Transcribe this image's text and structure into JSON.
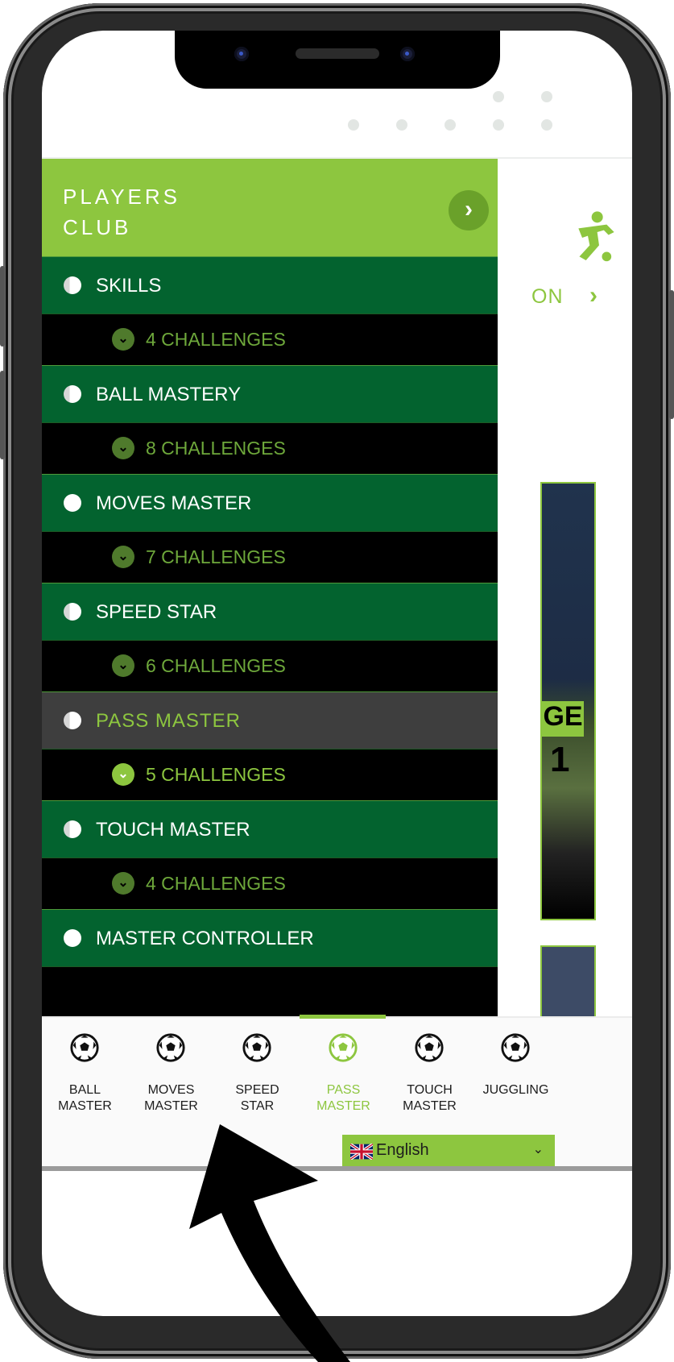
{
  "menu": {
    "title_line1": "PLAYERS",
    "title_line2": "CLUB",
    "categories": [
      {
        "label": "SKILLS",
        "challenges": "4 CHALLENGES"
      },
      {
        "label": "BALL MASTERY",
        "challenges": "8 CHALLENGES"
      },
      {
        "label": "MOVES MASTER",
        "challenges": "7 CHALLENGES"
      },
      {
        "label": "SPEED STAR",
        "challenges": "6 CHALLENGES"
      },
      {
        "label": "PASS MASTER",
        "challenges": "5 CHALLENGES",
        "active": true
      },
      {
        "label": "TOUCH MASTER",
        "challenges": "4 CHALLENGES"
      },
      {
        "label": "MASTER CONTROLLER"
      }
    ]
  },
  "background": {
    "partial_text": "ON",
    "challenge_tag": "GE",
    "challenge_number": "1"
  },
  "bottom_nav": {
    "items": [
      {
        "line1": "BALL",
        "line2": "MASTER"
      },
      {
        "line1": "MOVES",
        "line2": "MASTER"
      },
      {
        "line1": "SPEED",
        "line2": "STAR"
      },
      {
        "line1": "PASS",
        "line2": "MASTER",
        "active": true
      },
      {
        "line1": "TOUCH",
        "line2": "MASTER"
      },
      {
        "line1": "JUGGLING",
        "line2": ""
      }
    ]
  },
  "language": {
    "selected": "English"
  },
  "colors": {
    "accent_green": "#8dc63f",
    "menu_dark_green": "#03632f",
    "active_grey": "#3e3e3e"
  }
}
